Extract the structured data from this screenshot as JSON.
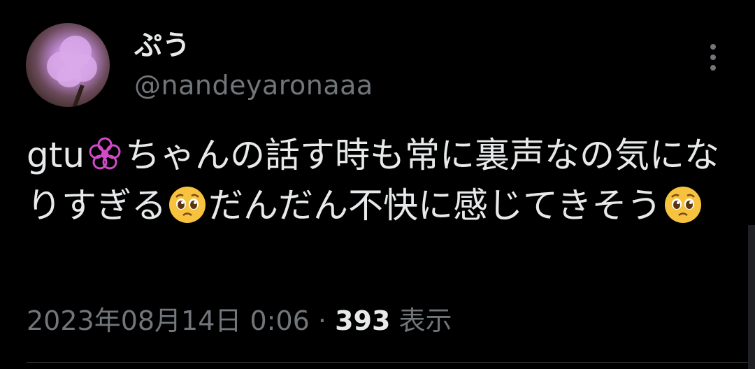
{
  "tweet": {
    "author": {
      "display_name": "ぷう",
      "handle": "@nandeyaronaaa",
      "avatar_icon": "cotton-candy-avatar"
    },
    "more_icon": "more-vertical-icon",
    "text": {
      "segment_1": "gtu",
      "emoji_1": "flower-emoji",
      "segment_2": "ちゃんの話す時も常に裏声なの気になりすぎる",
      "emoji_2": "pleading-face-emoji",
      "segment_3": "だんだん不快に感じてきそう",
      "emoji_3": "pleading-face-emoji"
    },
    "meta": {
      "timestamp": "2023年08月14日 0:06",
      "separator": " · ",
      "views_count": "393",
      "views_label": " 表示"
    }
  },
  "colors": {
    "background": "#000000",
    "primary_text": "#e7e9ea",
    "secondary_text": "#71767b",
    "divider": "#2f3336",
    "flower_accent": "#d24ac8",
    "emoji_yellow": "#f7c23e"
  }
}
